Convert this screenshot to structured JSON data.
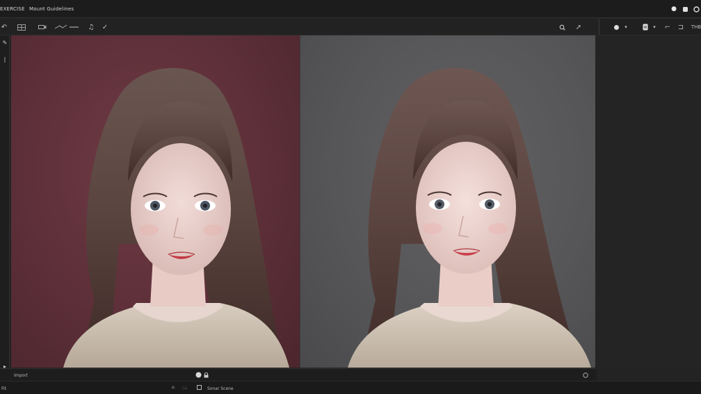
{
  "menubar": {
    "app_menu": "EXERCISE",
    "second_menu": "Mount Guidelines"
  },
  "rtoolbar": {
    "right_label": "THB"
  },
  "statusbar": {
    "left_label": "Import"
  },
  "bottombar": {
    "left_label": "Fit",
    "center_text": "Sonar Scene"
  },
  "colors": {
    "accent": "#cfcfcf",
    "left_backdrop": "#5d2f38",
    "right_backdrop": "#555557"
  }
}
